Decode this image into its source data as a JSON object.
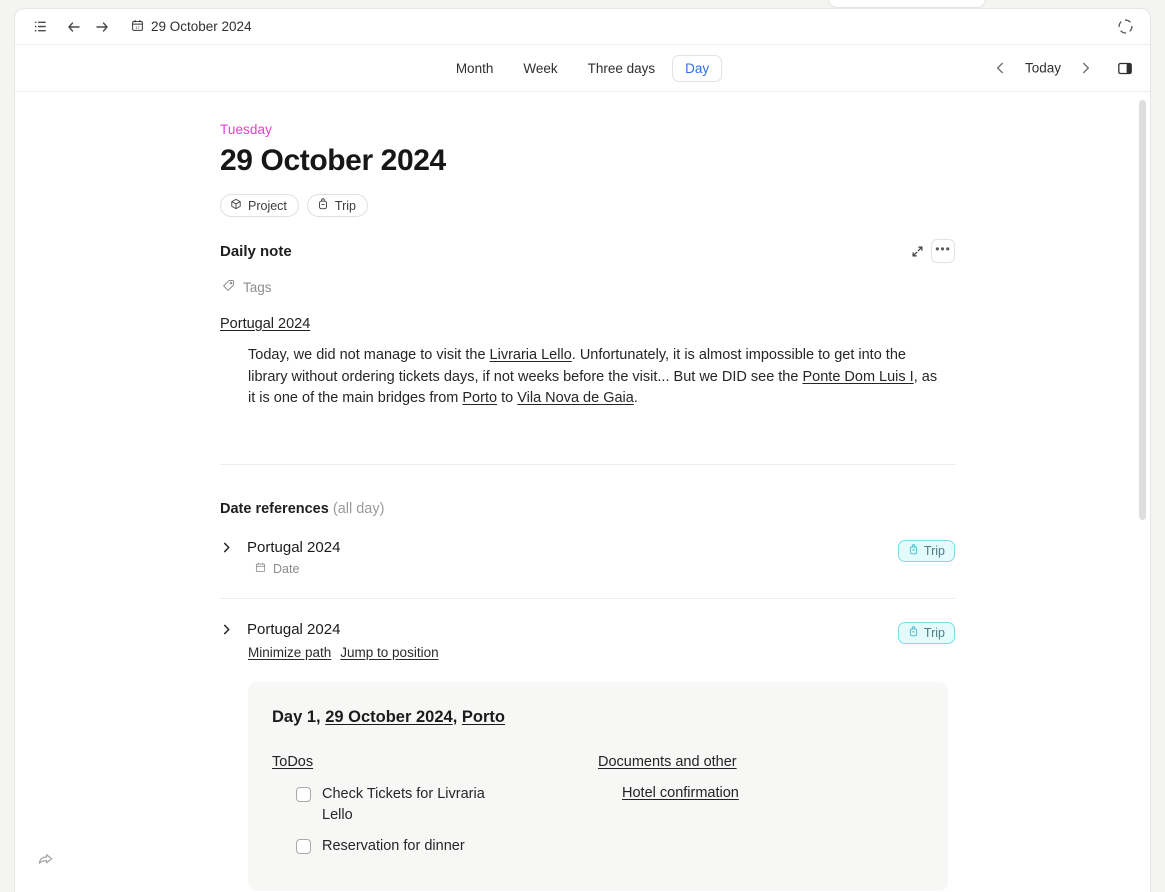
{
  "toolbar": {
    "breadcrumb": "29 October 2024",
    "icons": {
      "list": "list-icon",
      "back": "back-arrow-icon",
      "forward": "forward-arrow-icon",
      "calendar": "calendar-icon",
      "focus": "focus-mode-icon"
    }
  },
  "viewbar": {
    "tabs": [
      {
        "label": "Month",
        "active": false
      },
      {
        "label": "Week",
        "active": false
      },
      {
        "label": "Three days",
        "active": false
      },
      {
        "label": "Day",
        "active": true
      }
    ],
    "today_label": "Today",
    "prev_icon": "chevron-left-icon",
    "next_icon": "chevron-right-icon",
    "panel_icon": "toggle-sidepanel-icon"
  },
  "page": {
    "weekday": "Tuesday",
    "date_title": "29 October 2024",
    "chips": [
      {
        "label": "Project",
        "icon": "cube-icon"
      },
      {
        "label": "Trip",
        "icon": "backpack-icon"
      }
    ],
    "note": {
      "title": "Daily note",
      "expand_icon": "expand-diagonal-icon",
      "more_label": "•••",
      "tags_label": "Tags",
      "tags_icon": "tag-icon",
      "doc_link": "Portugal 2024",
      "paragraph": {
        "part1": "Today, we did not manage to visit the ",
        "link1": "Livraria Lello",
        "part2": ". Unfortunately, it is almost impossible to get into the library without ordering tickets days, if not weeks before the visit... But we DID see the ",
        "link2": "Ponte Dom Luis I",
        "part3": ", as it is one of the main bridges from ",
        "link3": "Porto",
        "part4": " to ",
        "link4": "Vila Nova de Gaia",
        "part5": "."
      }
    },
    "references": {
      "heading": "Date references",
      "heading_sub": "(all day)",
      "rows": [
        {
          "name": "Portugal 2024",
          "chevron": "chevron-right-icon",
          "badge": {
            "label": "Trip",
            "icon": "backpack-icon"
          },
          "sub_label": "Date",
          "sub_icon": "calendar-small-icon"
        },
        {
          "name": "Portugal 2024",
          "chevron": "chevron-right-icon",
          "badge": {
            "label": "Trip",
            "icon": "backpack-icon"
          },
          "path_links": [
            "Minimize path",
            "Jump to position"
          ]
        }
      ]
    },
    "embed": {
      "title_prefix": "Day 1, ",
      "title_date": "29 October 2024",
      "title_sep": ", ",
      "title_place": "Porto",
      "todos_header": "ToDos",
      "todos": [
        "Check Tickets for Livraria Lello",
        "Reservation for dinner"
      ],
      "docs_header": "Documents and other",
      "docs": [
        "Hotel confirmation"
      ]
    }
  },
  "share_icon": "share-arrow-icon"
}
